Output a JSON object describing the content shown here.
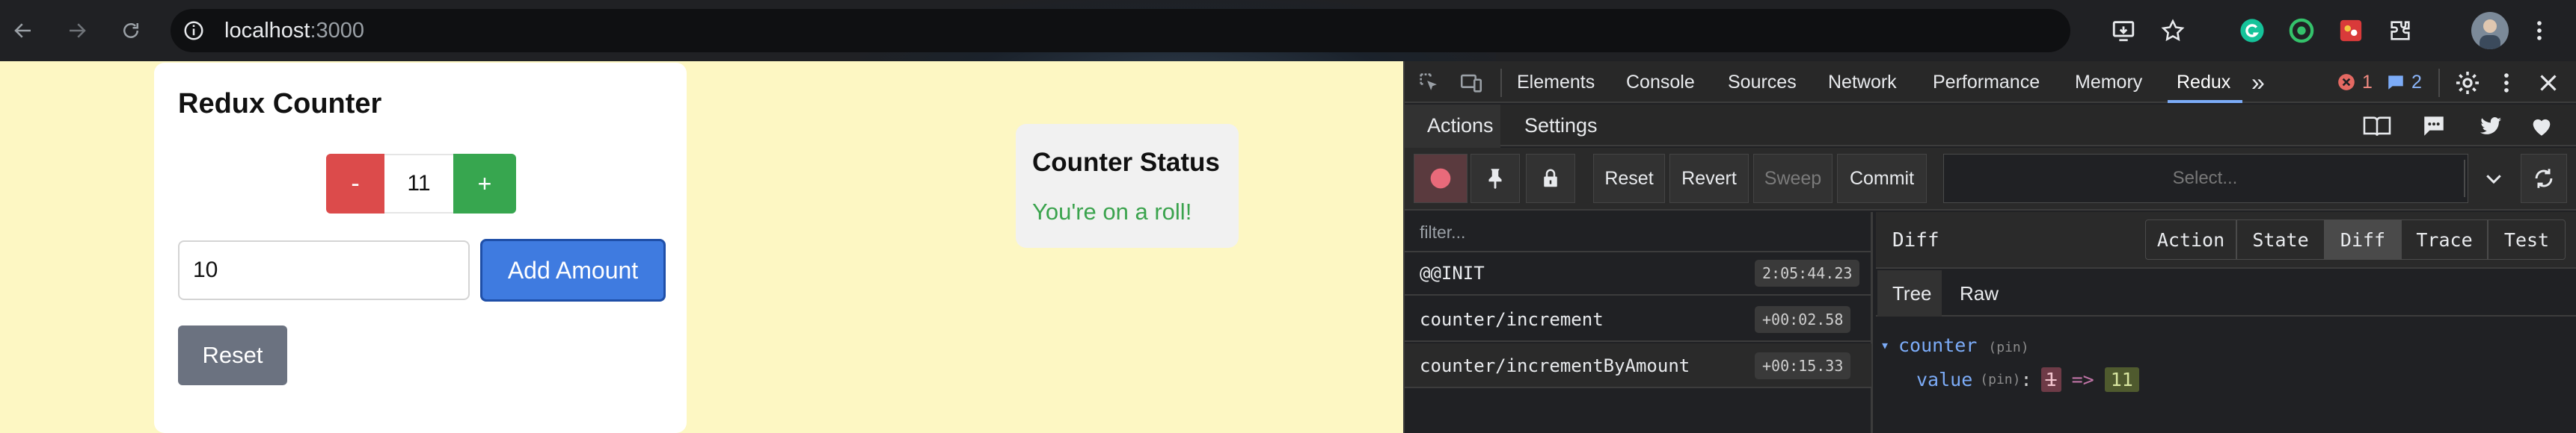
{
  "browser": {
    "url_host": "localhost",
    "url_port": ":3000",
    "icons": [
      "back-arrow-icon",
      "forward-arrow-icon",
      "reload-icon",
      "site-info-icon",
      "install-app-icon",
      "bookmark-star-icon",
      "grammarly-extension-icon",
      "circle-extension-icon",
      "red-extension-icon",
      "puzzle-extensions-icon",
      "profile-avatar"
    ]
  },
  "app": {
    "title": "Redux Counter",
    "minus_label": "-",
    "counter_value": "11",
    "plus_label": "+",
    "amount_input_value": "10",
    "add_label": "Add Amount",
    "reset_label": "Reset",
    "status_title": "Counter Status",
    "status_message": "You're on a roll!",
    "colors": {
      "minus": "#dc4b4b",
      "plus": "#37a64f",
      "add": "#3f7be0",
      "reset": "#6b7280",
      "status": "#3aa34d",
      "page_bg": "#fdf7c3"
    }
  },
  "devtools": {
    "tabs": [
      "Elements",
      "Console",
      "Sources",
      "Network",
      "Performance",
      "Memory",
      "Redux"
    ],
    "more_tabs": "»",
    "active_tab": "Redux",
    "error_count": "1",
    "message_count": "2",
    "redux": {
      "tabs": [
        "Actions",
        "Settings"
      ],
      "active_tab": "Actions",
      "toolbar": {
        "reset": "Reset",
        "revert": "Revert",
        "sweep": "Sweep",
        "commit": "Commit",
        "select_placeholder": "Select..."
      },
      "filter_placeholder": "filter...",
      "actions": [
        {
          "name": "@@INIT",
          "time": "2:05:44.23"
        },
        {
          "name": "counter/increment",
          "time": "+00:02.58"
        },
        {
          "name": "counter/incrementByAmount",
          "time": "+00:15.33"
        }
      ],
      "monitor_label": "Diff",
      "monitor_tabs": [
        "Action",
        "State",
        "Diff",
        "Trace",
        "Test"
      ],
      "active_monitor": "Diff",
      "subtabs": [
        "Tree",
        "Raw"
      ],
      "active_subtab": "Tree",
      "diff": {
        "arrow": "▾",
        "key": "counter",
        "pin": "(pin)",
        "child_key": "value",
        "child_pin": "(pin)",
        "colon": ":",
        "old_value": "1",
        "arrow_text": "=>",
        "new_value": "11"
      }
    }
  }
}
